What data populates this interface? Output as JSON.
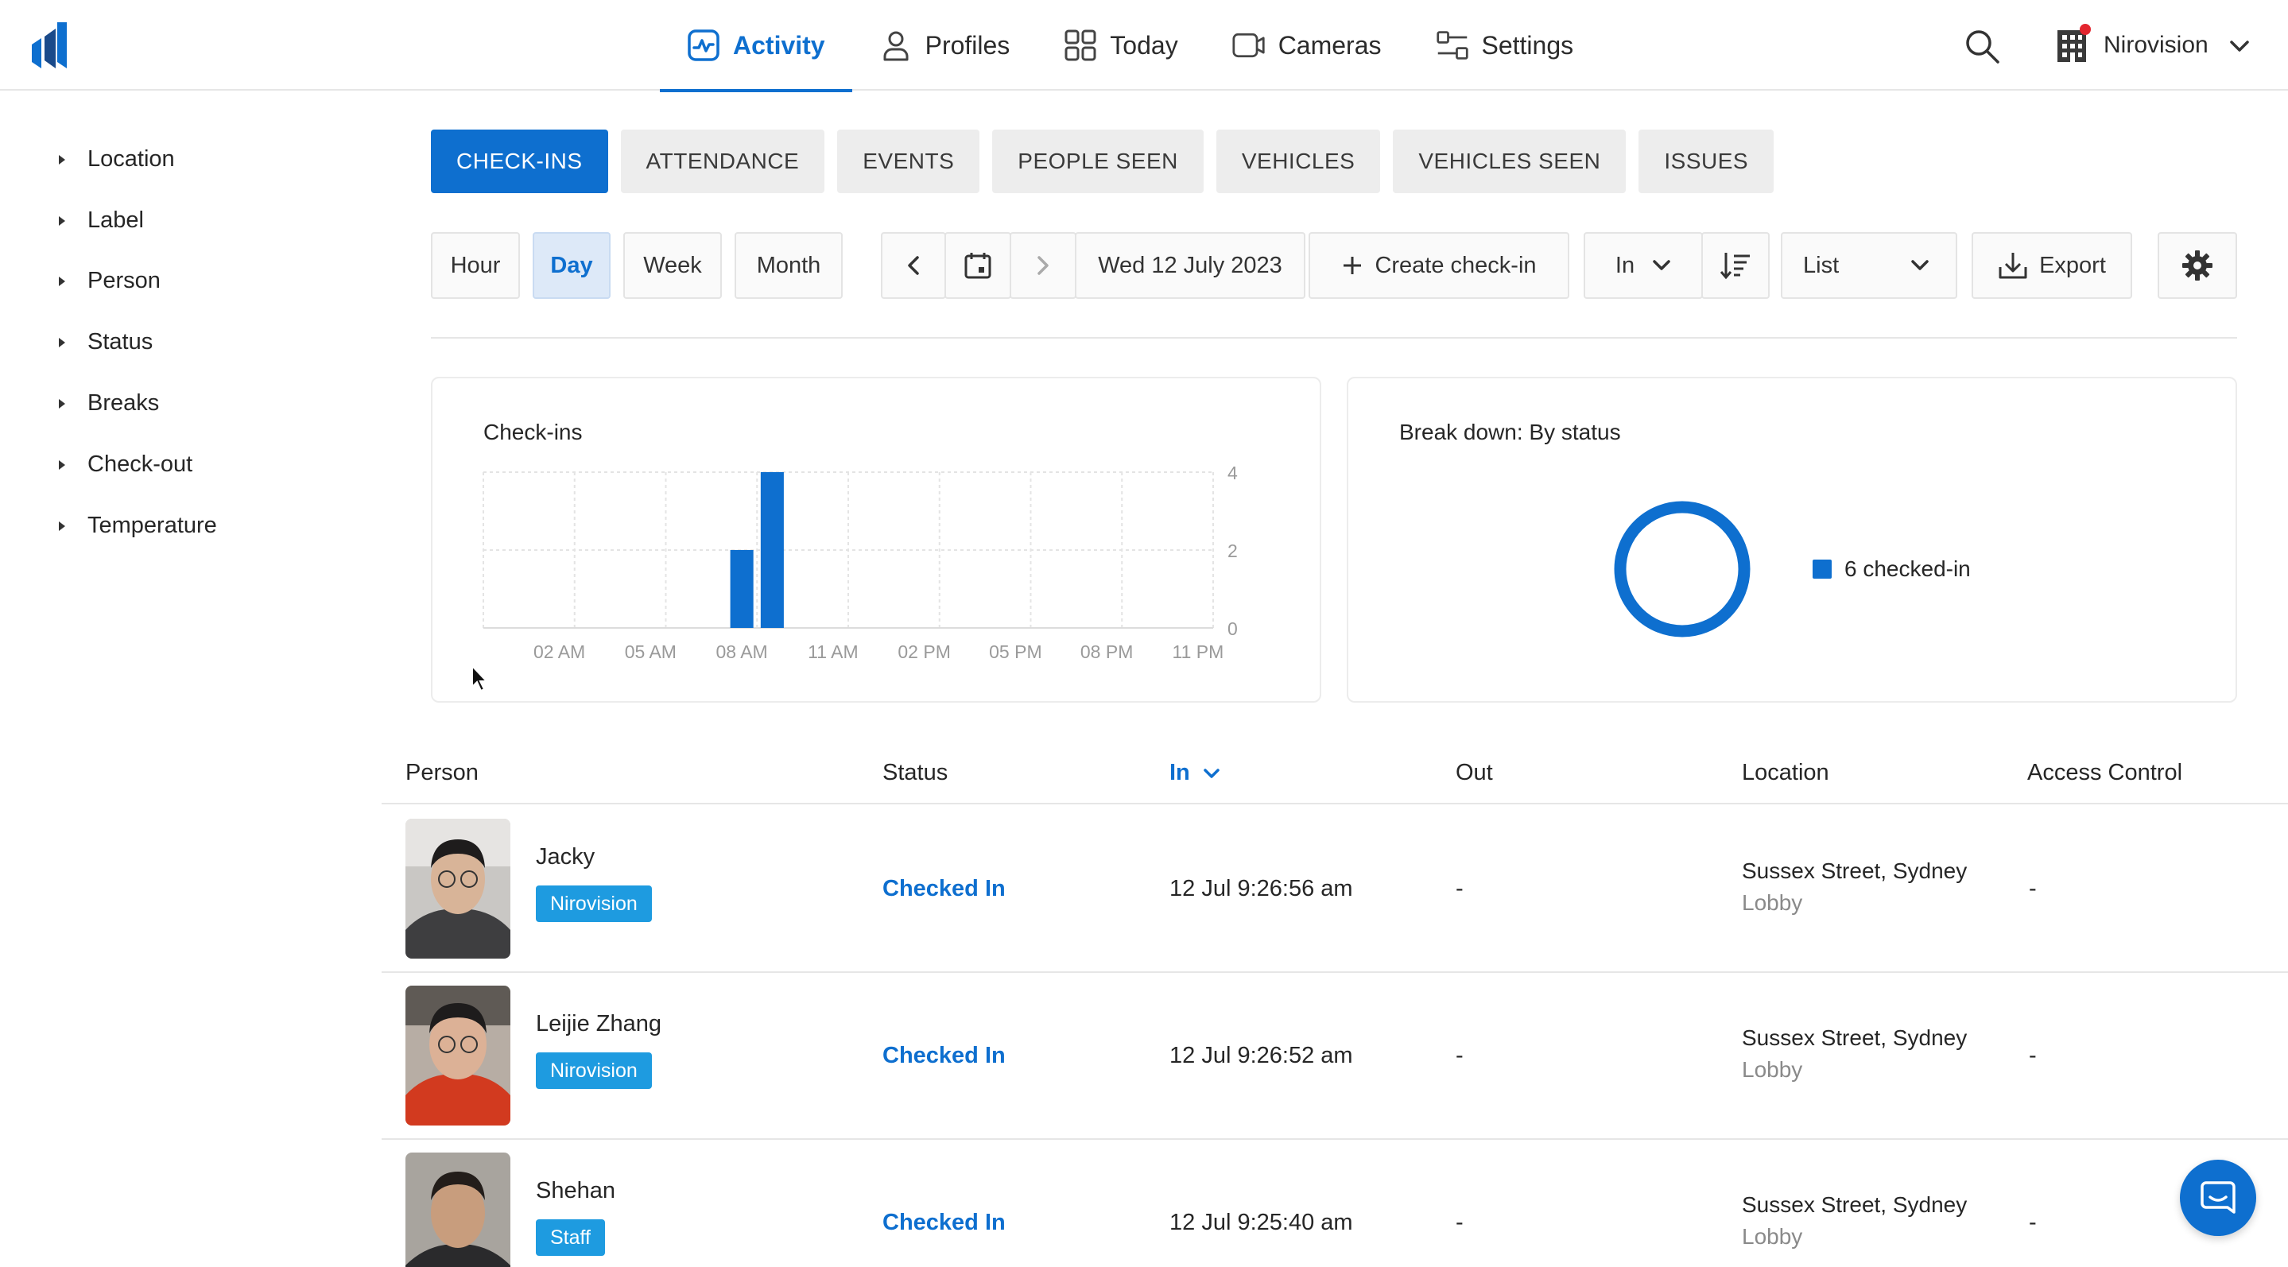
{
  "header": {
    "nav": [
      {
        "label": "Activity",
        "icon": "activity-icon",
        "active": true
      },
      {
        "label": "Profiles",
        "icon": "person-icon"
      },
      {
        "label": "Today",
        "icon": "grid-icon"
      },
      {
        "label": "Cameras",
        "icon": "camera-icon"
      },
      {
        "label": "Settings",
        "icon": "sliders-icon"
      }
    ],
    "org_name": "Nirovision"
  },
  "sidebar": {
    "filters": [
      "Location",
      "Label",
      "Person",
      "Status",
      "Breaks",
      "Check-out",
      "Temperature"
    ]
  },
  "tabs": [
    "CHECK-INS",
    "ATTENDANCE",
    "EVENTS",
    "PEOPLE SEEN",
    "VEHICLES",
    "VEHICLES SEEN",
    "ISSUES"
  ],
  "toolbar": {
    "ranges": [
      "Hour",
      "Day",
      "Week",
      "Month"
    ],
    "active_range": "Day",
    "date": "Wed 12 July 2023",
    "create_label": "Create check-in",
    "direction": "In",
    "view": "List",
    "export_label": "Export"
  },
  "checkins_card": {
    "title": "Check-ins"
  },
  "breakdown_card": {
    "title": "Break down: By status",
    "legend": "6 checked-in"
  },
  "colors": {
    "accent": "#0e6fcf",
    "badge": "#1e9be0"
  },
  "chart_data": {
    "type": "bar",
    "title": "Check-ins",
    "x_tick_labels": [
      "02 AM",
      "05 AM",
      "08 AM",
      "11 AM",
      "02 PM",
      "05 PM",
      "08 PM",
      "11 PM"
    ],
    "y_tick_labels": [
      "0",
      "2",
      "4"
    ],
    "ylim": [
      0,
      4
    ],
    "grid": true,
    "bars": [
      {
        "hour": 8,
        "value": 2
      },
      {
        "hour": 9,
        "value": 4
      }
    ]
  },
  "breakdown_chart": {
    "type": "pie",
    "slices": [
      {
        "label": "checked-in",
        "value": 6
      }
    ]
  },
  "table": {
    "columns": [
      "Person",
      "Status",
      "In",
      "Out",
      "Location",
      "Access Control"
    ],
    "sorted_column": "In",
    "rows": [
      {
        "name": "Jacky",
        "badge": "Nirovision",
        "status": "Checked In",
        "in": "12 Jul 9:26:56 am",
        "out": "-",
        "location": "Sussex Street, Sydney",
        "zone": "Lobby",
        "access": "-"
      },
      {
        "name": "Leijie Zhang",
        "badge": "Nirovision",
        "status": "Checked In",
        "in": "12 Jul 9:26:52 am",
        "out": "-",
        "location": "Sussex Street, Sydney",
        "zone": "Lobby",
        "access": "-"
      },
      {
        "name": "Shehan",
        "badge": "Staff",
        "status": "Checked In",
        "in": "12 Jul 9:25:40 am",
        "out": "-",
        "location": "Sussex Street, Sydney",
        "zone": "Lobby",
        "access": "-"
      }
    ]
  }
}
